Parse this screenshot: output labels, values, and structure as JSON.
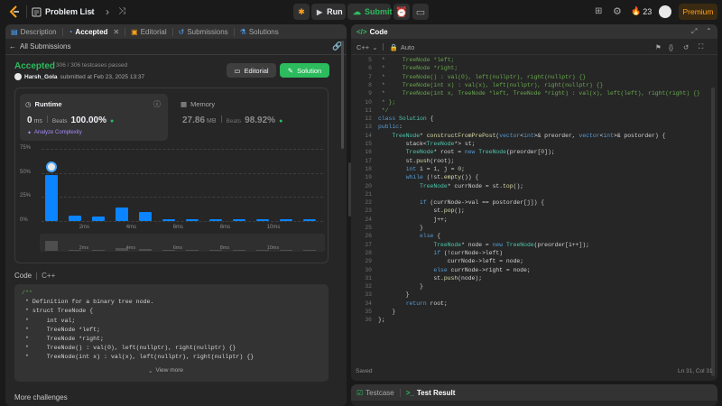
{
  "topbar": {
    "problem_list": "Problem List",
    "run": "Run",
    "submit": "Submit",
    "streak": "23",
    "premium": "Premium"
  },
  "left_tabs": [
    {
      "label": "Description",
      "icon": "description-icon"
    },
    {
      "label": "Accepted",
      "icon": "accepted-icon"
    },
    {
      "label": "Editorial",
      "icon": "editorial-icon"
    },
    {
      "label": "Submissions",
      "icon": "history-icon"
    },
    {
      "label": "Solutions",
      "icon": "flask-icon"
    }
  ],
  "submission": {
    "back_label": "All Submissions",
    "status": "Accepted",
    "testcases": "306 / 306 testcases passed",
    "user": "Harsh_Gola",
    "submitted_at": "submitted at Feb 23, 2025 13:37",
    "editorial_btn": "Editorial",
    "solution_btn": "Solution",
    "runtime_label": "Runtime",
    "runtime_value": "0",
    "runtime_unit": "ms",
    "beats_label": "Beats",
    "runtime_beats": "100.00%",
    "analyze": "Analyze Complexity",
    "memory_label": "Memory",
    "memory_value": "27.86",
    "memory_unit": "MB",
    "memory_beats": "98.92%"
  },
  "chart_data": {
    "type": "bar",
    "y_ticks": [
      "75%",
      "50%",
      "25%",
      "0%"
    ],
    "ylim": [
      0,
      75
    ],
    "x_tick_labels": [
      "2ms",
      "4ms",
      "6ms",
      "8ms",
      "10ms"
    ],
    "values": [
      48,
      6,
      5,
      14,
      9,
      2,
      2,
      2,
      2,
      2,
      2,
      2
    ],
    "bar_color": "#0a84ff",
    "grid": true
  },
  "code_section": {
    "title": "Code",
    "lang": "C++",
    "view_more": "View more",
    "lines": [
      "/**",
      " * Definition for a binary tree node.",
      " * struct TreeNode {",
      " *     int val;",
      " *     TreeNode *left;",
      " *     TreeNode *right;",
      " *     TreeNode() : val(0), left(nullptr), right(nullptr) {}",
      " *     TreeNode(int x) : val(x), left(nullptr), right(nullptr) {}"
    ]
  },
  "more_challenges": "More challenges",
  "editor": {
    "title": "Code",
    "language": "C++",
    "mode": "Auto",
    "saved": "Saved",
    "cursor": "Ln 31, Col 31",
    "start_line": 5,
    "lines": [
      " *     TreeNode *left;",
      " *     TreeNode *right;",
      " *     TreeNode() : val(0), left(nullptr), right(nullptr) {}",
      " *     TreeNode(int x) : val(x), left(nullptr), right(nullptr) {}",
      " *     TreeNode(int x, TreeNode *left, TreeNode *right) : val(x), left(left), right(right) {}",
      " * };",
      " */",
      "class Solution {",
      "public:",
      "    TreeNode* constructFromPrePost(vector<int>& preorder, vector<int>& postorder) {",
      "        stack<TreeNode*> st;",
      "        TreeNode* root = new TreeNode(preorder[0]);",
      "        st.push(root);",
      "        int i = 1, j = 0;",
      "        while (!st.empty()) {",
      "            TreeNode* currNode = st.top();",
      "",
      "            if (currNode->val == postorder[j]) {",
      "                st.pop();",
      "                j++;",
      "            }",
      "            else {",
      "                TreeNode* node = new TreeNode(preorder[i++]);",
      "                if (!currNode->left)",
      "                    currNode->left = node;",
      "                else currNode->right = node;",
      "                st.push(node);",
      "            }",
      "        }",
      "        return root;",
      "    }",
      "};"
    ]
  },
  "bottom_tabs": {
    "testcase": "Testcase",
    "result": "Test Result"
  }
}
